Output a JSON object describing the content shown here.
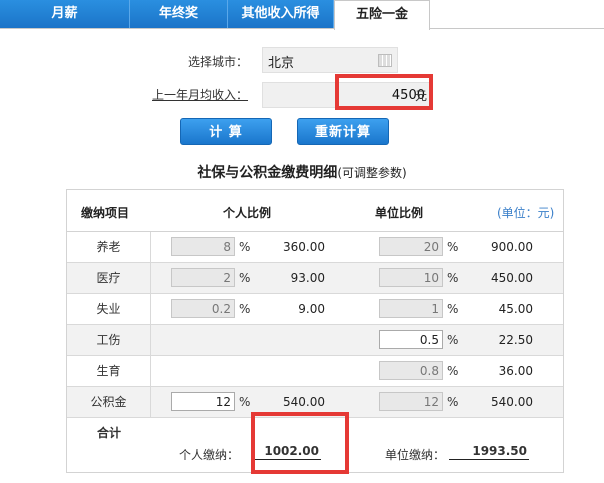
{
  "tabs": [
    {
      "label": "月薪"
    },
    {
      "label": "年终奖"
    },
    {
      "label": "其他收入所得"
    },
    {
      "label": "五险一金"
    }
  ],
  "form": {
    "city_label": "选择城市：",
    "city_value": "北京",
    "income_label": "上一年月均收入：",
    "income_value": "4500",
    "income_unit": "元",
    "calc_label": "计 算",
    "reset_label": "重新计算"
  },
  "section": {
    "title": "社保与公积金缴费明细",
    "note": "(可调整参数)"
  },
  "table": {
    "headers": {
      "item": "缴纳项目",
      "personal": "个人比例",
      "company": "单位比例",
      "unit": "(单位：元)"
    },
    "rows": [
      {
        "name": "养老",
        "p_rate": "8",
        "p_amount": "360.00",
        "c_rate": "20",
        "c_amount": "900.00"
      },
      {
        "name": "医疗",
        "p_rate": "2",
        "p_amount": "93.00",
        "c_rate": "10",
        "c_amount": "450.00"
      },
      {
        "name": "失业",
        "p_rate": "0.2",
        "p_amount": "9.00",
        "c_rate": "1",
        "c_amount": "45.00"
      },
      {
        "name": "工伤",
        "p_rate": "",
        "p_amount": "",
        "c_rate": "0.5",
        "c_amount": "22.50"
      },
      {
        "name": "生育",
        "p_rate": "",
        "p_amount": "",
        "c_rate": "0.8",
        "c_amount": "36.00"
      },
      {
        "name": "公积金",
        "p_rate": "12",
        "p_amount": "540.00",
        "c_rate": "12",
        "c_amount": "540.00"
      }
    ],
    "pct_sign": "%",
    "total": {
      "label": "合计",
      "personal_label": "个人缴纳：",
      "personal_value": "1002.00",
      "company_label": "单位缴纳：",
      "company_value": "1993.50"
    }
  },
  "colors": {
    "tab_blue": "#1b74c8",
    "highlight_red": "#e53935",
    "unit_blue": "#3a7fc9"
  }
}
